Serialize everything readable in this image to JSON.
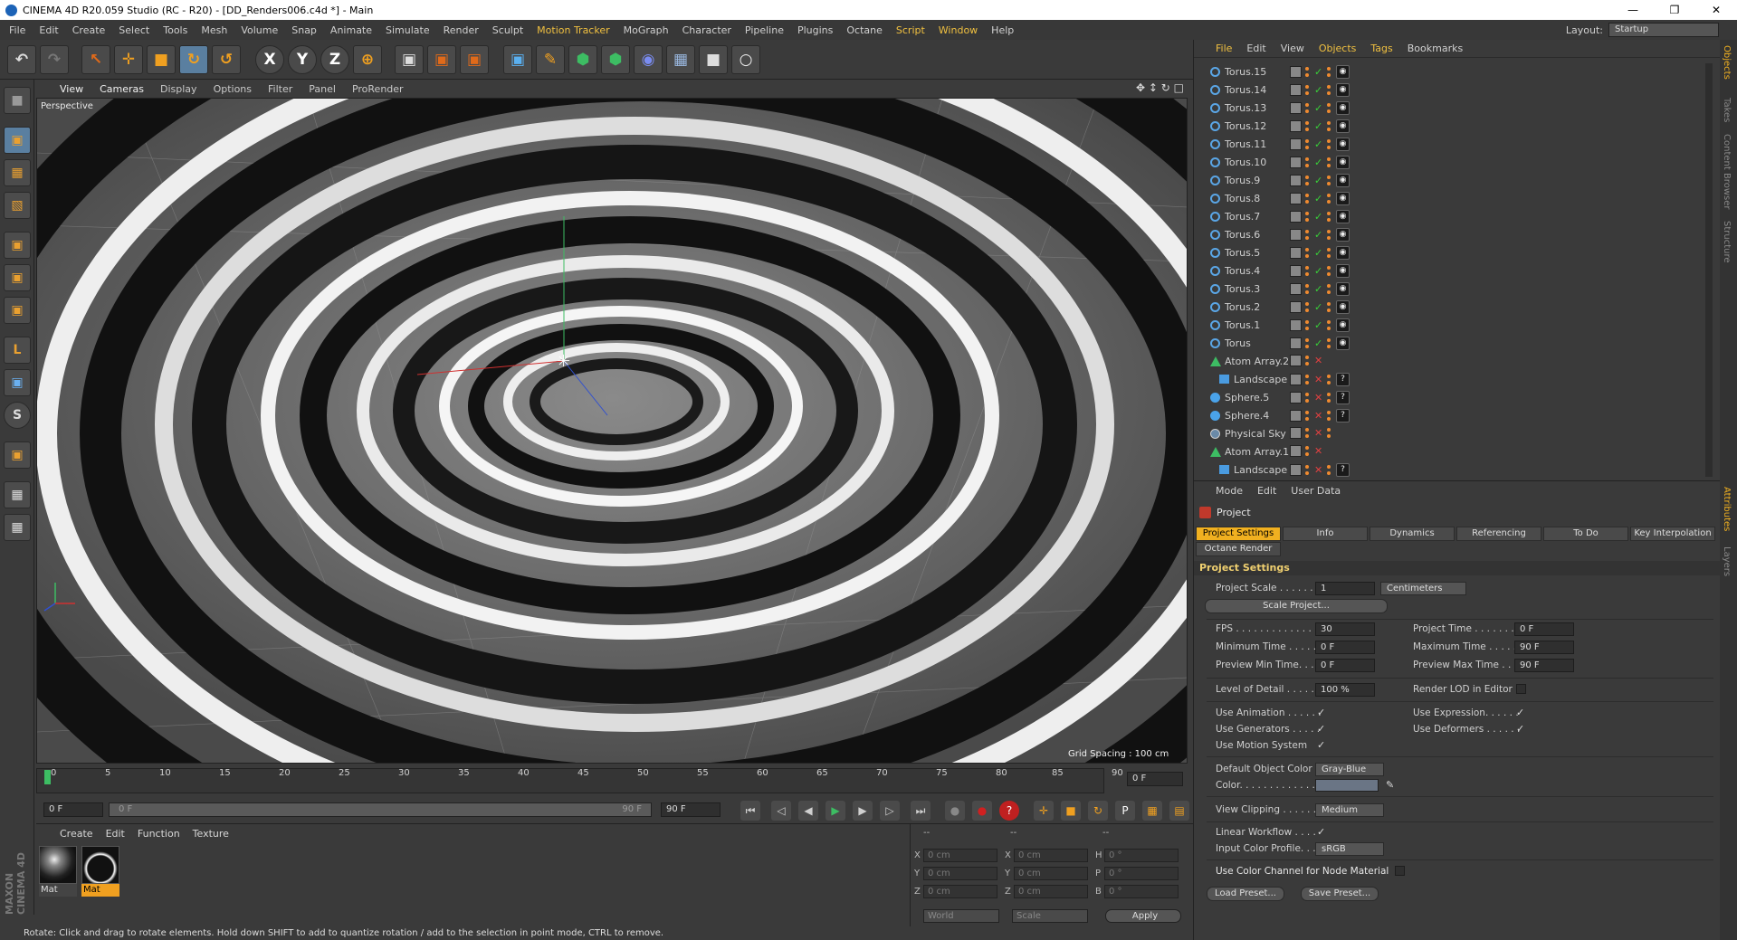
{
  "window": {
    "title": "CINEMA 4D R20.059 Studio (RC - R20) - [DD_Renders006.c4d *] - Main",
    "min": "—",
    "max": "❐",
    "close": "✕"
  },
  "menu": {
    "items": [
      "File",
      "Edit",
      "Create",
      "Select",
      "Tools",
      "Mesh",
      "Volume",
      "Snap",
      "Animate",
      "Simulate",
      "Render",
      "Sculpt",
      "Motion Tracker",
      "MoGraph",
      "Character",
      "Pipeline",
      "Plugins",
      "Octane",
      "Script",
      "Window",
      "Help"
    ],
    "layout_label": "Layout:",
    "layout_value": "Startup"
  },
  "toolbar": {
    "undo": "↶",
    "redo": "↷",
    "select": "↖",
    "move": "✛",
    "scale": "■",
    "rotate": "↻",
    "rotate2": "↺",
    "x": "X",
    "y": "Y",
    "z": "Z",
    "world": "⊕",
    "render_region": "▣",
    "render_view": "▣",
    "render_settings": "▣",
    "cube": "▣",
    "pen": "✎",
    "subdiv": "⬢",
    "array": "⬢",
    "deformer": "◉",
    "floor": "▦",
    "camera": "■",
    "light": "○"
  },
  "lefttools": {
    "t0": "■",
    "t1": "▣",
    "t2": "▦",
    "t3": "▧",
    "t4": "▣",
    "t5": "▣",
    "t6": "▣",
    "t7": "L",
    "t8": "▣",
    "t9": "S",
    "t10": "▣",
    "t11": "▦",
    "t12": "▦"
  },
  "viewport": {
    "menu": [
      "View",
      "Cameras",
      "Display",
      "Options",
      "Filter",
      "Panel",
      "ProRender"
    ],
    "label": "Perspective",
    "grid_spacing": "Grid Spacing : 100 cm",
    "nav": "✥ ↕ ↻ □"
  },
  "timeline": {
    "ticks": [
      "0",
      "5",
      "10",
      "15",
      "20",
      "25",
      "30",
      "35",
      "40",
      "45",
      "50",
      "55",
      "60",
      "65",
      "70",
      "75",
      "80",
      "85",
      "90"
    ],
    "end_field": "0 F",
    "start": "0 F",
    "range_start": "0 F",
    "range_end": "90 F",
    "end": "90 F"
  },
  "playback": {
    "first": "⏮",
    "prev_key": "◁",
    "prev": "◀",
    "play": "▶",
    "next": "▶",
    "next_key": "▷",
    "last": "⏭",
    "rec1": "●",
    "rec2": "●",
    "rec3": "?",
    "k1": "✛",
    "k2": "■",
    "k3": "↻",
    "k4": "P",
    "k5": "▦",
    "k6": "▤"
  },
  "materials": {
    "menu": [
      "Create",
      "Edit",
      "Function",
      "Texture"
    ],
    "items": [
      {
        "name": "Mat"
      },
      {
        "name": "Mat"
      }
    ]
  },
  "coords": {
    "head1": "--",
    "head2": "--",
    "head3": "--",
    "x": "X",
    "y": "Y",
    "z": "Z",
    "h": "H",
    "p": "P",
    "b": "B",
    "xv": "0 cm",
    "yv": "0 cm",
    "zv": "0 cm",
    "x2": "0 cm",
    "y2": "0 cm",
    "z2": "0 cm",
    "hv": "0 °",
    "pv": "0 °",
    "bv": "0 °",
    "world": "World",
    "scale": "Scale",
    "apply": "Apply"
  },
  "status": "Rotate: Click and drag to rotate elements. Hold down SHIFT to add to quantize rotation / add to the selection in point mode, CTRL to remove.",
  "objects": {
    "menu": [
      "File",
      "Edit",
      "View",
      "Objects",
      "Tags",
      "Bookmarks"
    ],
    "rows": [
      {
        "name": "Torus.15",
        "t": "torus",
        "v": "ok"
      },
      {
        "name": "Torus.14",
        "t": "torus",
        "v": "ok"
      },
      {
        "name": "Torus.13",
        "t": "torus",
        "v": "ok"
      },
      {
        "name": "Torus.12",
        "t": "torus",
        "v": "ok"
      },
      {
        "name": "Torus.11",
        "t": "torus",
        "v": "ok"
      },
      {
        "name": "Torus.10",
        "t": "torus",
        "v": "ok"
      },
      {
        "name": "Torus.9",
        "t": "torus",
        "v": "ok"
      },
      {
        "name": "Torus.8",
        "t": "torus",
        "v": "ok"
      },
      {
        "name": "Torus.7",
        "t": "torus",
        "v": "ok"
      },
      {
        "name": "Torus.6",
        "t": "torus",
        "v": "ok"
      },
      {
        "name": "Torus.5",
        "t": "torus",
        "v": "ok"
      },
      {
        "name": "Torus.4",
        "t": "torus",
        "v": "ok"
      },
      {
        "name": "Torus.3",
        "t": "torus",
        "v": "ok"
      },
      {
        "name": "Torus.2",
        "t": "torus",
        "v": "ok"
      },
      {
        "name": "Torus.1",
        "t": "torus",
        "v": "ok"
      },
      {
        "name": "Torus",
        "t": "torus",
        "v": "ok"
      },
      {
        "name": "Atom Array.2",
        "t": "gen",
        "v": "x"
      },
      {
        "name": "Landscape",
        "t": "land",
        "v": "x"
      },
      {
        "name": "Sphere.5",
        "t": "sph",
        "v": "x"
      },
      {
        "name": "Sphere.4",
        "t": "sph",
        "v": "x"
      },
      {
        "name": "Physical Sky",
        "t": "sky",
        "v": "x"
      },
      {
        "name": "Atom Array.1",
        "t": "gen",
        "v": "x"
      },
      {
        "name": "Landscape",
        "t": "land",
        "v": "x"
      }
    ]
  },
  "attributes": {
    "menu": [
      "Mode",
      "Edit",
      "User Data"
    ],
    "title": "Project",
    "tabs": [
      "Project Settings",
      "Info",
      "Dynamics",
      "Referencing",
      "To Do",
      "Key Interpolation",
      "Octane Render"
    ],
    "section": "Project Settings",
    "project_scale_label": "Project Scale . . . . . . .",
    "project_scale": "1",
    "scale_unit": "Centimeters",
    "scale_project": "Scale Project...",
    "fps_label": "FPS . . . . . . . . . . . . . . .",
    "fps": "30",
    "project_time_label": "Project Time . . . . . . . .",
    "project_time": "0 F",
    "min_time_label": "Minimum Time . . . . . . .",
    "min_time": "0 F",
    "max_time_label": "Maximum Time . . . . . . .",
    "max_time": "90 F",
    "prev_min_label": "Preview Min Time. . . . .",
    "prev_min": "0 F",
    "prev_max_label": "Preview Max Time . . . .",
    "prev_max": "90 F",
    "lod_label": "Level of Detail . . . . . .",
    "lod": "100 %",
    "render_lod_label": "Render LOD in Editor",
    "use_anim": "Use Animation . . . . . .",
    "use_expr": "Use Expression. . . . . .",
    "use_gen": "Use Generators . . . . .",
    "use_def": "Use Deformers . . . . . .",
    "use_motion": "Use Motion System",
    "def_color_label": "Default Object Color",
    "def_color": "Gray-Blue",
    "color_label": "Color. . . . . . . . . . . . . .",
    "view_clip_label": "View Clipping . . . . . .",
    "view_clip": "Medium",
    "linear_label": "Linear Workflow . . . .",
    "input_profile_label": "Input Color Profile. . .",
    "input_profile": "sRGB",
    "node_mat_label": "Use Color Channel for Node Material",
    "load_preset": "Load Preset...",
    "save_preset": "Save Preset..."
  },
  "righttabs": [
    "Objects",
    "Takes",
    "Content Browser",
    "Structure",
    "Attributes",
    "Layers"
  ],
  "logo": "MAXON CINEMA 4D"
}
